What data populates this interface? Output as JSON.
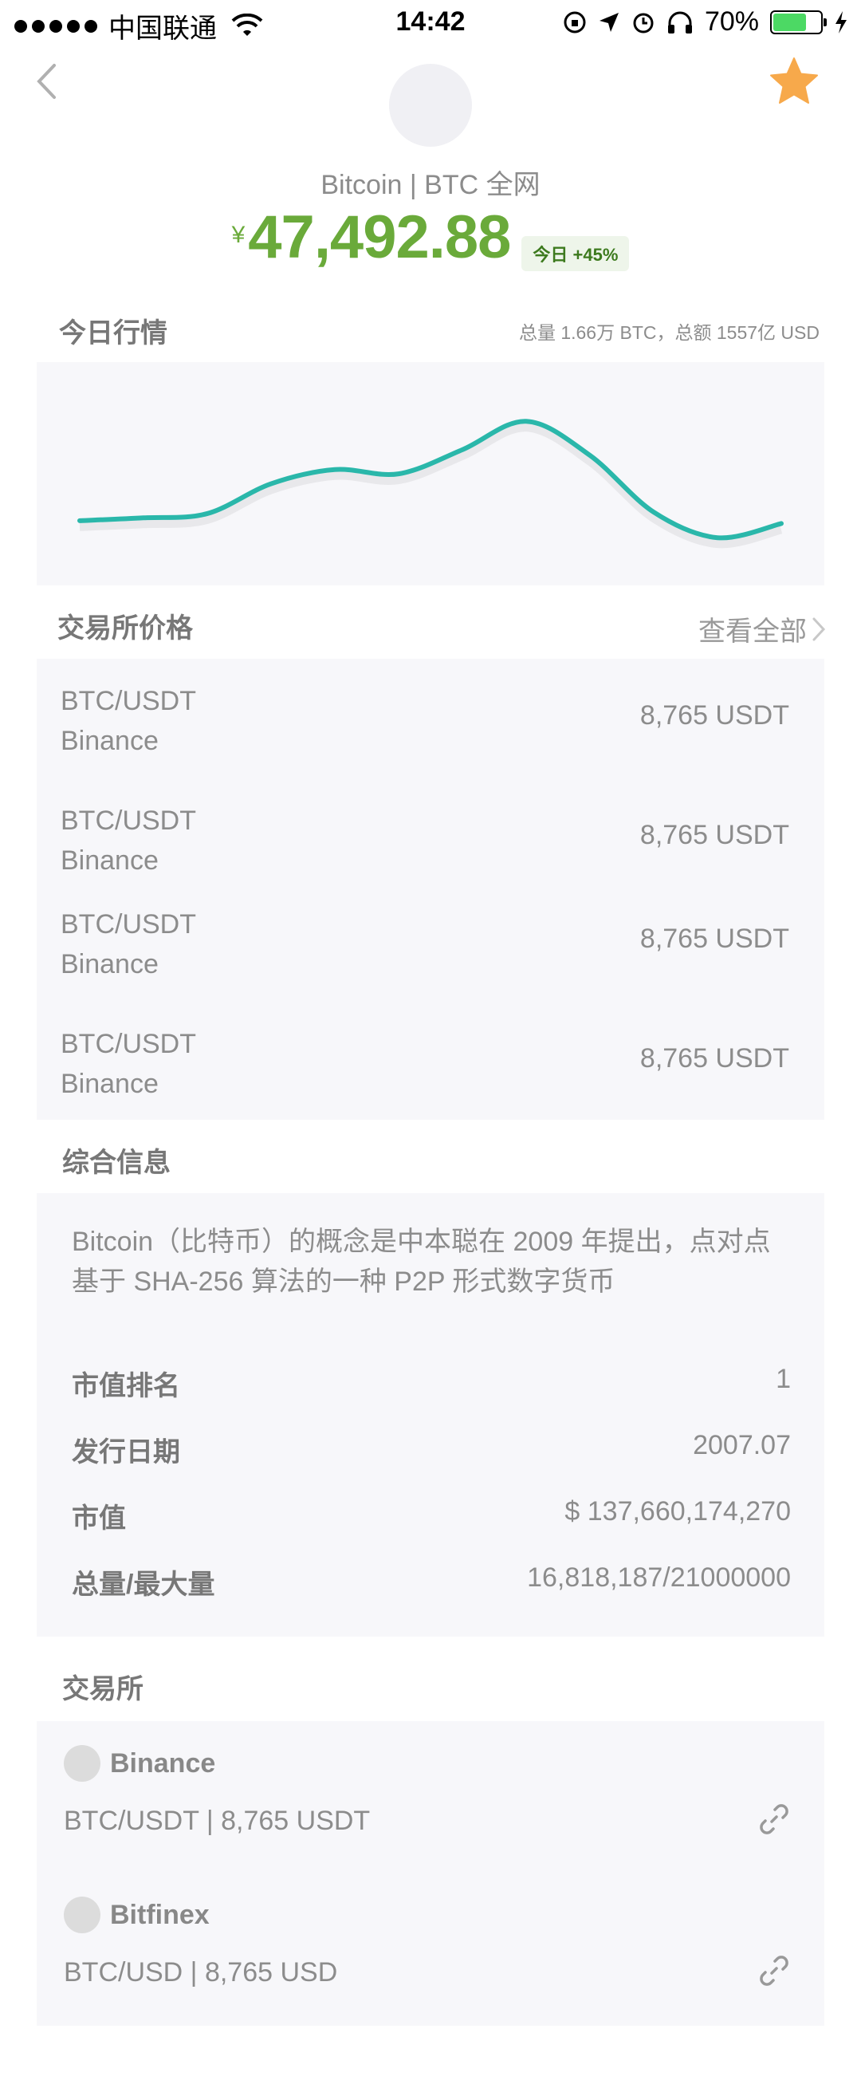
{
  "status_bar": {
    "carrier": "中国联通",
    "time": "14:42",
    "battery": "70%",
    "battery_level": 0.7
  },
  "header": {
    "coin_title": "Bitcoin | BTC 全网",
    "currency_symbol": "¥",
    "price": "47,492.88",
    "change_badge": "今日 +45%"
  },
  "today": {
    "title": "今日行情",
    "stats": "总量 1.66万 BTC，总额 1557亿 USD"
  },
  "chart_data": {
    "type": "line",
    "title": "",
    "xlabel": "",
    "ylabel": "",
    "grid": false,
    "color": "#2ab7aa",
    "y": [
      22,
      24,
      27,
      48,
      58,
      55,
      72,
      92,
      68,
      28,
      10,
      20
    ]
  },
  "exchange_prices": {
    "title": "交易所价格",
    "view_all": "查看全部",
    "rows": [
      {
        "pair": "BTC/USDT",
        "exchange": "Binance",
        "price": "8,765 USDT"
      },
      {
        "pair": "BTC/USDT",
        "exchange": "Binance",
        "price": "8,765 USDT"
      },
      {
        "pair": "BTC/USDT",
        "exchange": "Binance",
        "price": "8,765 USDT"
      },
      {
        "pair": "BTC/USDT",
        "exchange": "Binance",
        "price": "8,765 USDT"
      }
    ]
  },
  "info": {
    "title": "综合信息",
    "description": "Bitcoin（比特币）的概念是中本聪在 2009 年提出，点对点基于 SHA-256 算法的一种 P2P 形式数字货币",
    "rows": [
      {
        "label": "市值排名",
        "value": "1"
      },
      {
        "label": "发行日期",
        "value": "2007.07"
      },
      {
        "label": "市值",
        "value": "$ 137,660,174,270"
      },
      {
        "label": "总量/最大量",
        "value": "16,818,187/21000000"
      }
    ]
  },
  "markets": {
    "title": "交易所",
    "items": [
      {
        "name": "Binance",
        "pair_price": "BTC/USDT | 8,765 USDT"
      },
      {
        "name": "Bitfinex",
        "pair_price": "BTC/USD | 8,765 USD"
      }
    ]
  },
  "colors": {
    "price_green": "#6aaa3a",
    "chart_line": "#2ab7aa",
    "star": "#f7a94b",
    "panel_bg": "#f7f7fa"
  }
}
